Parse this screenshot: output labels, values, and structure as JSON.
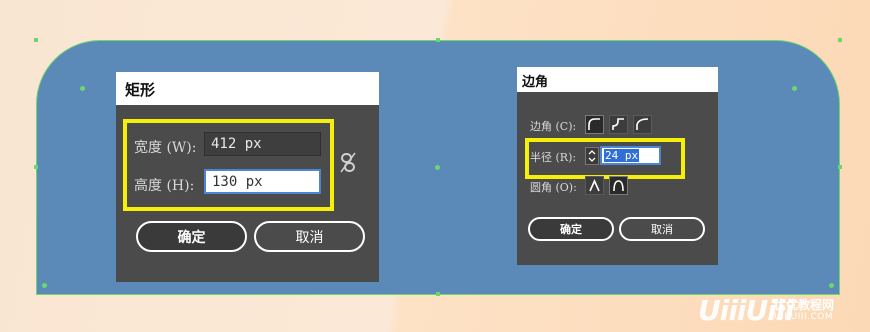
{
  "rect_dialog": {
    "title": "矩形",
    "width_label": "宽度 (W):",
    "width_value": "412 px",
    "height_label": "高度 (H):",
    "height_value": "130 px",
    "link_icon": "unlink-icon",
    "ok_label": "确定",
    "cancel_label": "取消"
  },
  "corner_dialog": {
    "title": "边角",
    "corner_label": "边角 (C):",
    "corner_types": [
      "rounded-corner-icon",
      "inverted-corner-icon",
      "chamfer-corner-icon"
    ],
    "radius_label": "半径 (R):",
    "radius_value": "24 px",
    "rounding_label": "圆角 (O):",
    "rounding_types": [
      "relative-rounding-icon",
      "absolute-rounding-icon"
    ],
    "ok_label": "确定",
    "cancel_label": "取消"
  },
  "watermark": {
    "logo": "UiiiUiii",
    "site_name": "优优教程网",
    "url": "UIIIUIII.COM"
  },
  "colors": {
    "shape_fill": "#5b8ab9",
    "selection": "#6cd86a",
    "highlight": "#f5ef0a",
    "dialog_bg": "#4b4b4b"
  }
}
